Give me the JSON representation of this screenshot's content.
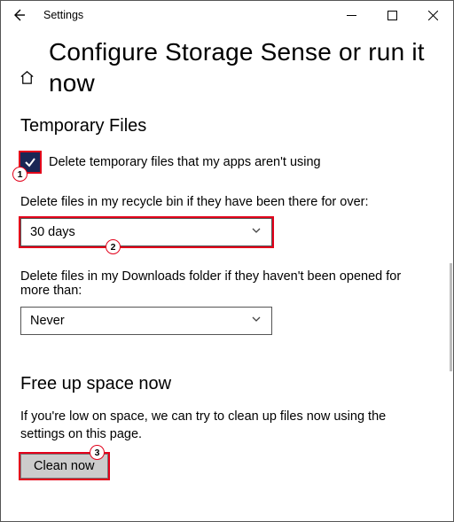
{
  "titlebar": {
    "app_name": "Settings"
  },
  "header": {
    "page_title": "Configure Storage Sense or run it now"
  },
  "temp_files": {
    "heading": "Temporary Files",
    "checkbox_label": "Delete temporary files that my apps aren't using",
    "recycle_label": "Delete files in my recycle bin if they have been there for over:",
    "recycle_value": "30 days",
    "downloads_label": "Delete files in my Downloads folder if they haven't been opened for more than:",
    "downloads_value": "Never"
  },
  "free_up": {
    "heading": "Free up space now",
    "description": "If you're low on space, we can try to clean up files now using the settings on this page.",
    "button": "Clean now"
  },
  "annotations": {
    "b1": "1",
    "b2": "2",
    "b3": "3"
  }
}
